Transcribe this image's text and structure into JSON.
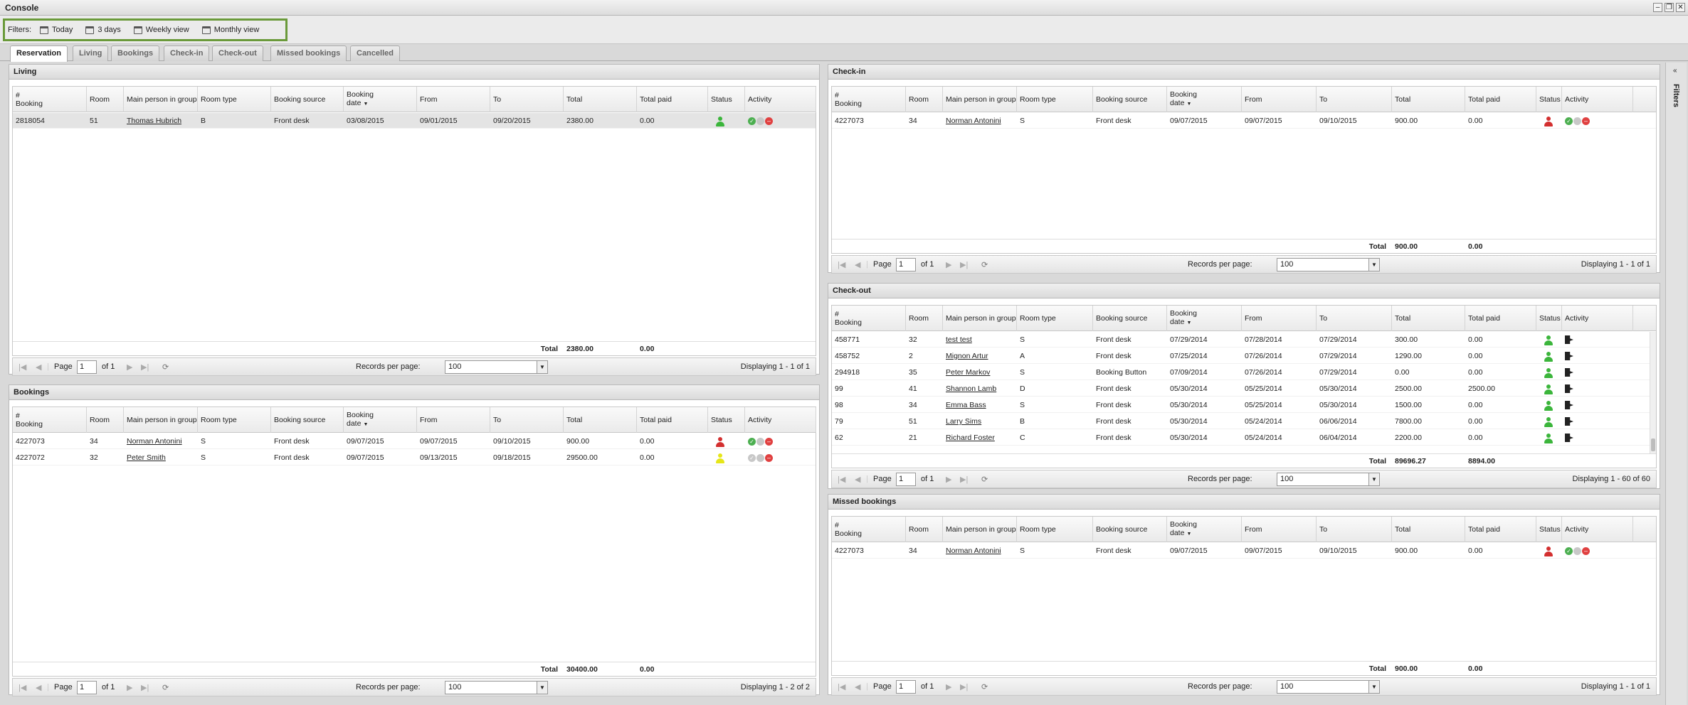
{
  "window": {
    "title": "Console"
  },
  "filters": {
    "label": "Filters:",
    "items": [
      "Today",
      "3 days",
      "Weekly view",
      "Monthly view"
    ]
  },
  "tabs": [
    "Reservation",
    "Living",
    "Bookings",
    "Check-in",
    "Check-out",
    "Missed bookings",
    "Cancelled"
  ],
  "sidebar": {
    "label": "Filters"
  },
  "columns": {
    "booking_line1": "#",
    "booking_line2": "Booking",
    "room": "Room",
    "main_person": "Main person in group",
    "room_type": "Room type",
    "booking_source": "Booking source",
    "booking_date_line1": "Booking",
    "booking_date_line2": "date",
    "from": "From",
    "to": "To",
    "total": "Total",
    "total_paid": "Total paid",
    "status": "Status",
    "activity": "Activity"
  },
  "pager_labels": {
    "page": "Page",
    "records_per_page": "Records per page:",
    "total": "Total"
  },
  "panels": {
    "living": {
      "title": "Living",
      "rows": [
        {
          "booking": "2818054",
          "room": "51",
          "person": "Thomas Hubrich",
          "type": "B",
          "source": "Front desk",
          "date": "03/08/2015",
          "from": "09/01/2015",
          "to": "09/20/2015",
          "total": "2380.00",
          "paid": "0.00",
          "status": "green",
          "activity": "ops"
        }
      ],
      "total": "2380.00",
      "total_paid": "0.00",
      "page": "1",
      "of": "of 1",
      "rpp": "100",
      "displaying": "Displaying 1 - 1 of 1"
    },
    "bookings": {
      "title": "Bookings",
      "rows": [
        {
          "booking": "4227073",
          "room": "34",
          "person": "Norman Antonini",
          "type": "S",
          "source": "Front desk",
          "date": "09/07/2015",
          "from": "09/07/2015",
          "to": "09/10/2015",
          "total": "900.00",
          "paid": "0.00",
          "status": "red",
          "activity": "ops"
        },
        {
          "booking": "4227072",
          "room": "32",
          "person": "Peter Smith",
          "type": "S",
          "source": "Front desk",
          "date": "09/07/2015",
          "from": "09/13/2015",
          "to": "09/18/2015",
          "total": "29500.00",
          "paid": "0.00",
          "status": "yellow",
          "activity": "ops-dim"
        }
      ],
      "total": "30400.00",
      "total_paid": "0.00",
      "page": "1",
      "of": "of 1",
      "rpp": "100",
      "displaying": "Displaying 1 - 2 of 2"
    },
    "checkin": {
      "title": "Check-in",
      "rows": [
        {
          "booking": "4227073",
          "room": "34",
          "person": "Norman Antonini",
          "type": "S",
          "source": "Front desk",
          "date": "09/07/2015",
          "from": "09/07/2015",
          "to": "09/10/2015",
          "total": "900.00",
          "paid": "0.00",
          "status": "red",
          "activity": "ops"
        }
      ],
      "total": "900.00",
      "total_paid": "0.00",
      "page": "1",
      "of": "of 1",
      "rpp": "100",
      "displaying": "Displaying 1 - 1 of 1"
    },
    "checkout": {
      "title": "Check-out",
      "rows": [
        {
          "booking": "458771",
          "room": "32",
          "person": "test test",
          "type": "S",
          "source": "Front desk",
          "date": "07/29/2014",
          "from": "07/28/2014",
          "to": "07/29/2014",
          "total": "300.00",
          "paid": "0.00",
          "status": "green",
          "activity": "exit"
        },
        {
          "booking": "458752",
          "room": "2",
          "person": "Mignon Artur",
          "type": "A",
          "source": "Front desk",
          "date": "07/25/2014",
          "from": "07/26/2014",
          "to": "07/29/2014",
          "total": "1290.00",
          "paid": "0.00",
          "status": "green",
          "activity": "exit"
        },
        {
          "booking": "294918",
          "room": "35",
          "person": "Peter Markov",
          "type": "S",
          "source": "Booking Button",
          "date": "07/09/2014",
          "from": "07/26/2014",
          "to": "07/29/2014",
          "total": "0.00",
          "paid": "0.00",
          "status": "green",
          "activity": "exit"
        },
        {
          "booking": "99",
          "room": "41",
          "person": "Shannon Lamb",
          "type": "D",
          "source": "Front desk",
          "date": "05/30/2014",
          "from": "05/25/2014",
          "to": "05/30/2014",
          "total": "2500.00",
          "paid": "2500.00",
          "status": "green",
          "activity": "exit"
        },
        {
          "booking": "98",
          "room": "34",
          "person": "Emma Bass",
          "type": "S",
          "source": "Front desk",
          "date": "05/30/2014",
          "from": "05/25/2014",
          "to": "05/30/2014",
          "total": "1500.00",
          "paid": "0.00",
          "status": "green",
          "activity": "exit"
        },
        {
          "booking": "79",
          "room": "51",
          "person": "Larry Sims",
          "type": "B",
          "source": "Front desk",
          "date": "05/30/2014",
          "from": "05/24/2014",
          "to": "06/06/2014",
          "total": "7800.00",
          "paid": "0.00",
          "status": "green",
          "activity": "exit"
        },
        {
          "booking": "62",
          "room": "21",
          "person": "Richard Foster",
          "type": "C",
          "source": "Front desk",
          "date": "05/30/2014",
          "from": "05/24/2014",
          "to": "06/04/2014",
          "total": "2200.00",
          "paid": "0.00",
          "status": "green",
          "activity": "exit"
        }
      ],
      "total": "89696.27",
      "total_paid": "8894.00",
      "page": "1",
      "of": "of 1",
      "rpp": "100",
      "displaying": "Displaying 1 - 60 of 60"
    },
    "missed": {
      "title": "Missed bookings",
      "rows": [
        {
          "booking": "4227073",
          "room": "34",
          "person": "Norman Antonini",
          "type": "S",
          "source": "Front desk",
          "date": "09/07/2015",
          "from": "09/07/2015",
          "to": "09/10/2015",
          "total": "900.00",
          "paid": "0.00",
          "status": "red",
          "activity": "ops"
        }
      ],
      "total": "900.00",
      "total_paid": "0.00",
      "page": "1",
      "of": "of 1",
      "rpp": "100",
      "displaying": "Displaying 1 - 1 of 1"
    }
  },
  "colors": {
    "green": "#3bb53b",
    "red": "#d32f2f",
    "yellow": "#e6e619",
    "accent": "#6a9a3a"
  }
}
